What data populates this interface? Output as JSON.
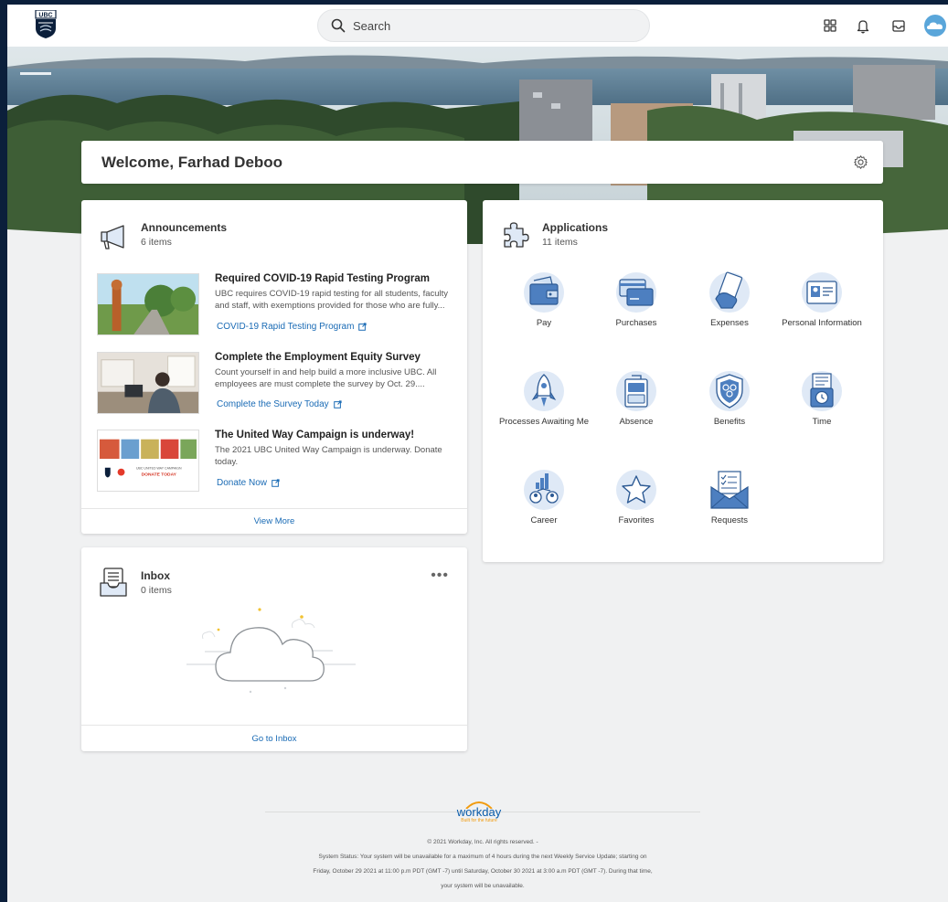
{
  "header": {
    "search_placeholder": "Search",
    "icons": [
      "ubc-logo-icon",
      "search-icon",
      "apps-grid-icon",
      "bell-icon",
      "inbox-tray-icon",
      "avatar-cloud-icon"
    ]
  },
  "welcome": {
    "title": "Welcome, Farhad Deboo"
  },
  "announcements": {
    "title": "Announcements",
    "count": "6 items",
    "items": [
      {
        "title": "Required COVID-19 Rapid Testing Program",
        "body": "UBC requires COVID-19 rapid testing for all students, faculty and staff, with exemptions provided for those who are fully...",
        "link": "COVID-19 Rapid Testing Program"
      },
      {
        "title": "Complete the Employment Equity Survey",
        "body": "Count yourself in and help build a more inclusive UBC. All employees are must complete the survey by Oct. 29....",
        "link": "Complete the Survey Today"
      },
      {
        "title": "The United Way Campaign is underway!",
        "body": "The 2021 UBC United Way Campaign is underway. Donate today.",
        "link": "Donate Now"
      }
    ],
    "thumb3_text_a": "UBC UNITED WAY CAMPAIGN",
    "thumb3_text_b": "DONATE TODAY",
    "view_more": "View More"
  },
  "applications": {
    "title": "Applications",
    "count": "11 items",
    "apps": [
      {
        "label": "Pay",
        "icon": "wallet-icon"
      },
      {
        "label": "Purchases",
        "icon": "credit-card-icon"
      },
      {
        "label": "Expenses",
        "icon": "receipt-hand-icon"
      },
      {
        "label": "Personal Information",
        "icon": "id-card-icon"
      },
      {
        "label": "Processes Awaiting Me",
        "icon": "rocket-icon"
      },
      {
        "label": "Absence",
        "icon": "suitcase-icon"
      },
      {
        "label": "Benefits",
        "icon": "shield-icon"
      },
      {
        "label": "Time",
        "icon": "clock-icon"
      },
      {
        "label": "Career",
        "icon": "career-icon"
      },
      {
        "label": "Favorites",
        "icon": "star-icon"
      },
      {
        "label": "Requests",
        "icon": "envelope-icon"
      }
    ]
  },
  "inbox": {
    "title": "Inbox",
    "count": "0 items",
    "more": "•••",
    "footer_link": "Go to Inbox"
  },
  "footer": {
    "brand": "workday",
    "tagline": "Built for the future",
    "copyright": "© 2021 Workday, Inc. All rights reserved. -",
    "status_line1": "System Status: Your system will be unavailable for a maximum of 4 hours during the next Weekly Service Update; starting on",
    "status_line2": "Friday, October 29 2021 at 11:00 p.m PDT (GMT -7) until Saturday, October 30 2021 at 3:00 a.m PDT (GMT -7). During that time,",
    "status_line3": "your system will be unavailable."
  },
  "colors": {
    "navy": "#0b1f3b",
    "link_blue": "#1a6bb5",
    "icon_blue": "#3e6fb0",
    "icon_bg": "#dfe9f6"
  }
}
